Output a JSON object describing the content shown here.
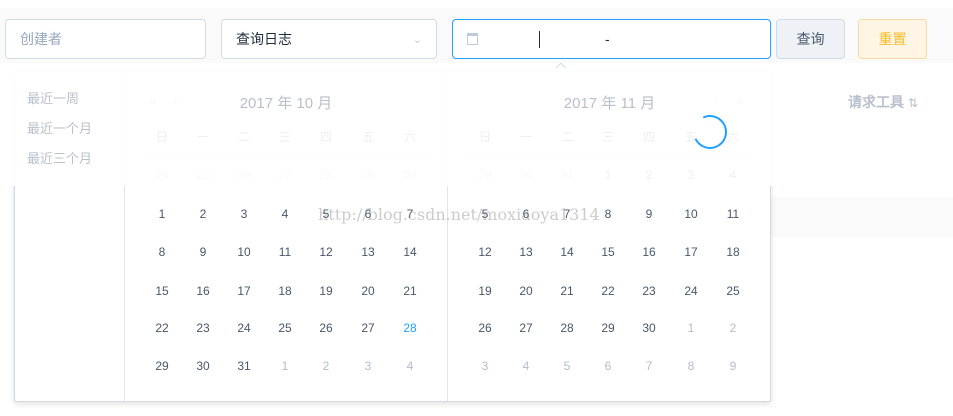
{
  "toolbar": {
    "creator_placeholder": "创建者",
    "log_type_value": "查询日志",
    "date_separator": "-",
    "query_label": "查询",
    "reset_label": "重置"
  },
  "table": {
    "header_tool": "请求工具",
    "sort_icon": "⇅"
  },
  "picker": {
    "shortcuts": [
      "最近一周",
      "最近一个月",
      "最近三个月"
    ],
    "weekdays": [
      "日",
      "一",
      "二",
      "三",
      "四",
      "五",
      "六"
    ],
    "left": {
      "title": "2017 年 10 月",
      "rows": [
        [
          24,
          25,
          26,
          27,
          28,
          29,
          30
        ],
        [
          1,
          2,
          3,
          4,
          5,
          6,
          7
        ],
        [
          8,
          9,
          10,
          11,
          12,
          13,
          14
        ],
        [
          15,
          16,
          17,
          18,
          19,
          20,
          21
        ],
        [
          22,
          23,
          24,
          25,
          26,
          27,
          28
        ],
        [
          29,
          30,
          31,
          1,
          2,
          3,
          4
        ]
      ],
      "other_month": [
        [
          1,
          1,
          1,
          1,
          1,
          1,
          1
        ],
        [
          0,
          0,
          0,
          0,
          0,
          0,
          0
        ],
        [
          0,
          0,
          0,
          0,
          0,
          0,
          0
        ],
        [
          0,
          0,
          0,
          0,
          0,
          0,
          0
        ],
        [
          0,
          0,
          0,
          0,
          0,
          0,
          0
        ],
        [
          0,
          0,
          0,
          1,
          1,
          1,
          1
        ]
      ],
      "today": [
        4,
        6
      ]
    },
    "right": {
      "title": "2017 年 11 月",
      "rows": [
        [
          29,
          30,
          31,
          1,
          2,
          3,
          4
        ],
        [
          5,
          6,
          7,
          8,
          9,
          10,
          11
        ],
        [
          12,
          13,
          14,
          15,
          16,
          17,
          18
        ],
        [
          19,
          20,
          21,
          22,
          23,
          24,
          25
        ],
        [
          26,
          27,
          28,
          29,
          30,
          1,
          2
        ],
        [
          3,
          4,
          5,
          6,
          7,
          8,
          9
        ]
      ],
      "other_month": [
        [
          1,
          1,
          1,
          0,
          0,
          0,
          0
        ],
        [
          0,
          0,
          0,
          0,
          0,
          0,
          0
        ],
        [
          0,
          0,
          0,
          0,
          0,
          0,
          0
        ],
        [
          0,
          0,
          0,
          0,
          0,
          0,
          0
        ],
        [
          0,
          0,
          0,
          0,
          0,
          1,
          1
        ],
        [
          1,
          1,
          1,
          1,
          1,
          1,
          1
        ]
      ]
    }
  },
  "watermark": "http://blog.csdn.net/moxiaoya1314",
  "colors": {
    "accent": "#20a0ff",
    "reset_text": "#f7ba2a"
  }
}
